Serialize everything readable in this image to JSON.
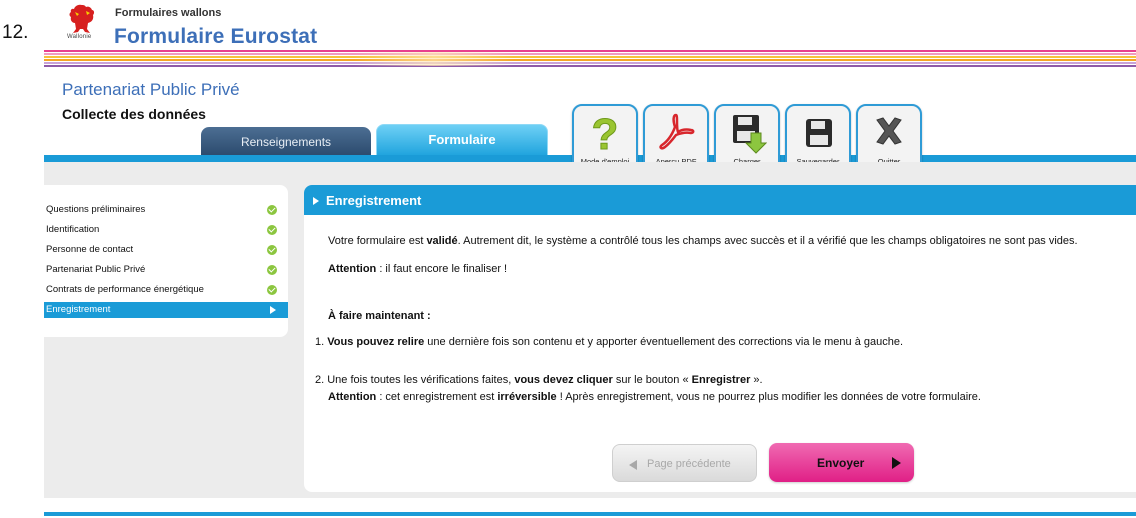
{
  "document_number": "12.",
  "brand": {
    "logo_text": "Wallonie",
    "subtitle": "Formulaires wallons",
    "title": "Formulaire Eurostat"
  },
  "header": {
    "project": "Partenariat Public Privé",
    "section": "Collecte des données"
  },
  "tabs": [
    {
      "label": "Renseignements",
      "active": false
    },
    {
      "label": "Formulaire",
      "active": true
    }
  ],
  "toolbar": [
    {
      "label": "Mode d'emploi",
      "icon": "help-icon"
    },
    {
      "label": "Aperçu PDF",
      "icon": "pdf-icon"
    },
    {
      "label": "Charger",
      "icon": "load-icon"
    },
    {
      "label": "Sauvegarder",
      "icon": "save-icon"
    },
    {
      "label": "Quitter",
      "icon": "close-icon"
    }
  ],
  "sidebar": {
    "items": [
      {
        "label": "Questions préliminaires",
        "status": "done"
      },
      {
        "label": "Identification",
        "status": "done"
      },
      {
        "label": "Personne de contact",
        "status": "done"
      },
      {
        "label": "Partenariat Public Privé",
        "status": "done"
      },
      {
        "label": "Contrats de performance énergétique",
        "status": "done"
      },
      {
        "label": "Enregistrement",
        "status": "active"
      }
    ]
  },
  "panel": {
    "title": "Enregistrement",
    "p1": {
      "a": "Votre formulaire est ",
      "b": "validé",
      "c": ". Autrement dit, le système a contrôlé tous les champs avec succès et il a vérifié que les champs obligatoires ne sont pas vides."
    },
    "p2": {
      "a": "Attention",
      "b": " : il faut encore le finaliser !"
    },
    "todo_title": "À faire maintenant :",
    "step1": {
      "num": "1. ",
      "b": "Vous pouvez relire",
      "c": " une dernière fois son contenu et y apporter éventuellement des corrections via le menu à gauche."
    },
    "step2": {
      "num": "2. ",
      "a": "Une fois toutes les vérifications faites, ",
      "b": "vous devez cliquer",
      "c": " sur le bouton « ",
      "d": "Enregistrer",
      "e": " »."
    },
    "step2b": {
      "a": "Attention",
      "b": " : cet enregistrement est ",
      "c": "irréversible",
      "d": " ! Après enregistrement, vous ne pourrez plus modifier les données de votre formulaire."
    }
  },
  "buttons": {
    "previous": "Page précédente",
    "send": "Envoyer"
  },
  "colors": {
    "accent_blue": "#1a9bd7",
    "title_blue": "#3d6fb8",
    "success_green": "#8cc63f",
    "send_pink": "#e01f86"
  }
}
